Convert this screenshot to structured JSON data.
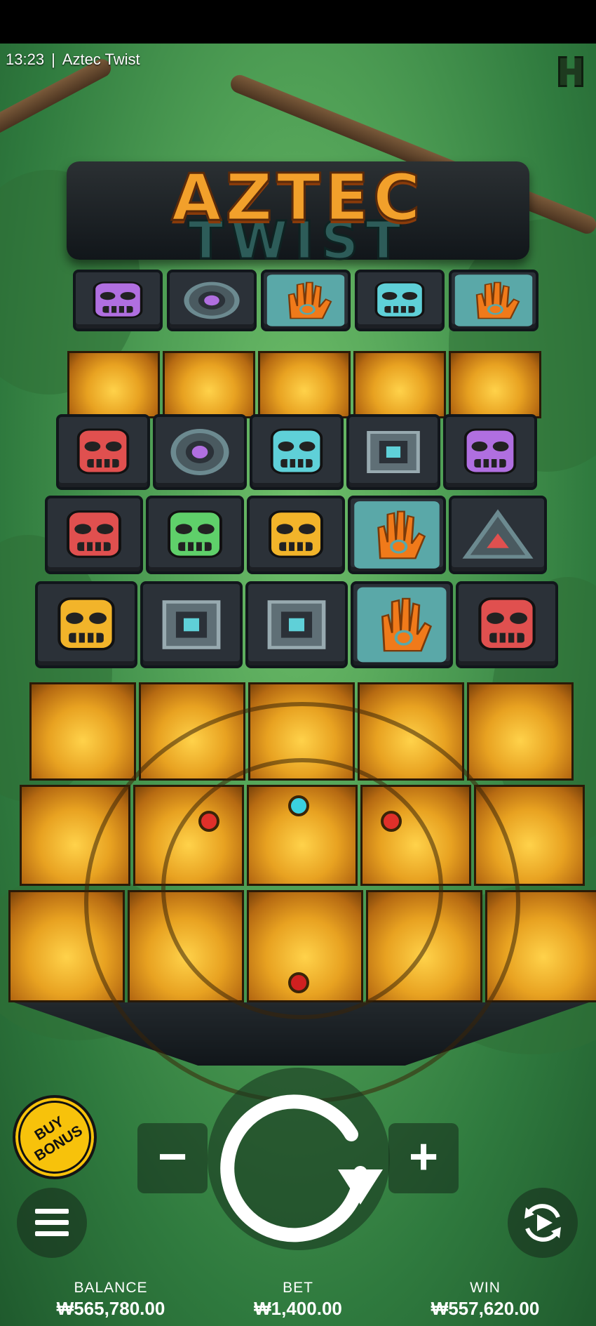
{
  "status_bar": {
    "time": "13:23",
    "separator": "|",
    "game_title": "Aztec Twist"
  },
  "logo": {
    "line1": "AZTEC",
    "line2": "TWIST"
  },
  "grid": {
    "rows": [
      [
        "purple-skull",
        "purple-ring",
        "orange-hand",
        "teal-skull",
        "orange-hand"
      ],
      [
        "gold",
        "gold",
        "gold",
        "gold",
        "gold"
      ],
      [
        "red-skull",
        "purple-ring",
        "teal-skull",
        "teal-square",
        "purple-skull"
      ],
      [
        "red-skull",
        "green-skull",
        "gold-skull",
        "orange-hand",
        "red-triangle"
      ],
      [
        "gold-skull",
        "teal-square",
        "teal-square",
        "orange-hand",
        "red-skull"
      ]
    ],
    "colors": {
      "purple": "#b06fe0",
      "teal": "#5fd0d8",
      "red": "#e0504f",
      "green": "#5fd06a",
      "gold": "#f2b42a",
      "orange": "#f07a1a"
    }
  },
  "controls": {
    "buy_bonus": {
      "line1": "BUY",
      "line2": "BONUS"
    },
    "minus": "−",
    "plus": "+",
    "menu_icon": "menu-icon",
    "autoplay_icon": "autoplay-icon",
    "spin_icon": "spin-icon"
  },
  "footer": {
    "balance_label": "BALANCE",
    "balance_value": "₩565,780.00",
    "bet_label": "BET",
    "bet_value": "₩1,400.00",
    "win_label": "WIN",
    "win_value": "₩557,620.00"
  }
}
